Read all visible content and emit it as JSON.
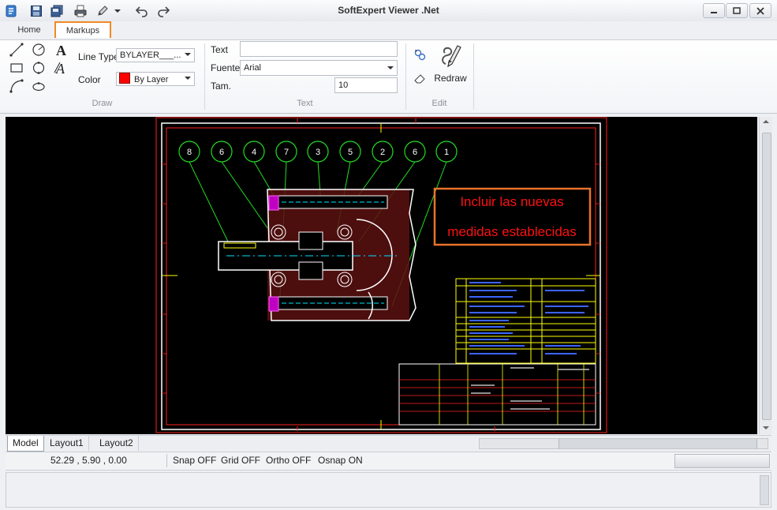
{
  "window": {
    "title": "SoftExpert Viewer .Net"
  },
  "quick_access": [
    "save-icon",
    "save-all-icon",
    "print-icon",
    "pen-icon",
    "undo-icon",
    "redo-icon"
  ],
  "tabs": {
    "home": "Home",
    "markups": "Markups"
  },
  "draw": {
    "group_label": "Draw",
    "line_type_label": "Line Type",
    "line_type_value": "BYLAYER___...",
    "color_label": "Color",
    "color_value": "By Layer",
    "color_swatch": "#ff0000"
  },
  "text_group": {
    "group_label": "Text",
    "text_label": "Text",
    "text_value": "",
    "font_label": "Fuente",
    "font_value": "Arial",
    "size_label": "Tam.",
    "size_value": "10"
  },
  "edit": {
    "group_label": "Edit",
    "redraw_label": "Redraw"
  },
  "drawing": {
    "balloons": [
      "8",
      "6",
      "4",
      "7",
      "3",
      "5",
      "2",
      "6",
      "1"
    ],
    "markup_lines": [
      "Incluir las nuevas",
      "medidas establecidas"
    ],
    "markup_color": "#e8732a"
  },
  "layouts": [
    "Model",
    "Layout1",
    "Layout2"
  ],
  "status": {
    "coords": "52.29 , 5.90 , 0.00",
    "snap": "Snap OFF",
    "grid": "Grid OFF",
    "ortho": "Ortho OFF",
    "osnap": "Osnap ON"
  }
}
